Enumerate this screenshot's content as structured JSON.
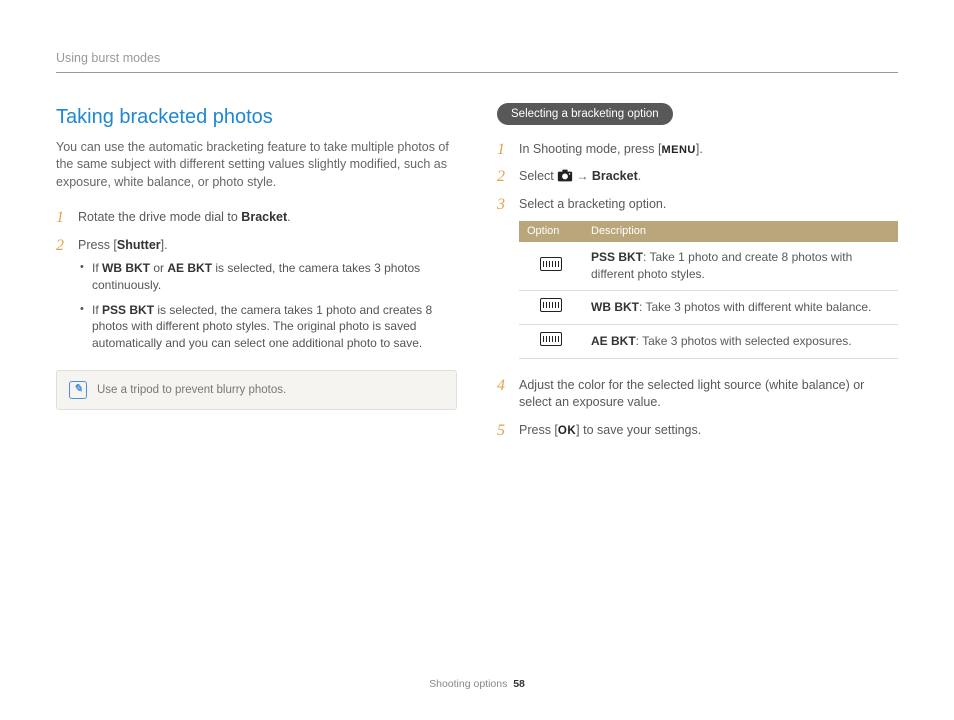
{
  "header": {
    "breadcrumb": "Using burst modes"
  },
  "left": {
    "title": "Taking bracketed photos",
    "intro": "You can use the automatic bracketing feature to take multiple photos of the same subject with different setting values slightly modified, such as exposure, white balance, or photo style.",
    "step1_pre": "Rotate the drive mode dial to ",
    "step1_bold": "Bracket",
    "step1_post": ".",
    "step2_pre": "Press [",
    "step2_bold": "Shutter",
    "step2_post": "].",
    "bullet1_pre": "If ",
    "bullet1_b1": "WB BKT",
    "bullet1_mid": " or ",
    "bullet1_b2": "AE BKT",
    "bullet1_post": " is selected, the camera takes 3 photos continuously.",
    "bullet2_pre": "If ",
    "bullet2_b1": "PSS BKT",
    "bullet2_post": " is selected, the camera takes 1 photo and creates 8 photos with different photo styles. The original photo is saved automatically and you can select one additional photo to save.",
    "note": "Use a tripod to prevent blurry photos."
  },
  "right": {
    "pill": "Selecting a bracketing option",
    "s1_pre": "In Shooting mode, press [",
    "s1_menu": "MENU",
    "s1_post": "].",
    "s2_pre": "Select ",
    "s2_arrow": " → ",
    "s2_bold": "Bracket",
    "s2_post": ".",
    "s3": "Select a bracketing option.",
    "table": {
      "h1": "Option",
      "h2": "Description",
      "rows": [
        {
          "name": "PSS BKT",
          "desc": ": Take 1 photo and create 8 photos with different photo styles."
        },
        {
          "name": "WB BKT",
          "desc": ": Take 3 photos with different white balance."
        },
        {
          "name": "AE BKT",
          "desc": ": Take 3 photos with selected exposures."
        }
      ]
    },
    "s4": "Adjust the color for the selected light source (white balance) or select an exposure value.",
    "s5_pre": "Press [",
    "s5_ok": "OK",
    "s5_post": "] to save your settings."
  },
  "footer": {
    "section": "Shooting options",
    "page": "58"
  }
}
